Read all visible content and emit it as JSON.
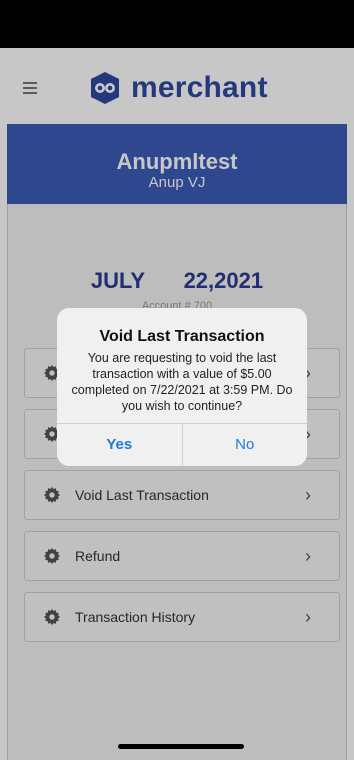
{
  "app": {
    "brand": "merchant"
  },
  "merchant": {
    "name": "Anupmltest",
    "user": "Anup VJ"
  },
  "date": {
    "month": "JULY",
    "day_year": "22,2021"
  },
  "account": {
    "text": "Account # 700"
  },
  "menu": [
    {
      "label": "",
      "icon": "gear-icon"
    },
    {
      "label": "",
      "icon": "gear-icon"
    },
    {
      "label": "Void Last Transaction",
      "icon": "gear-icon"
    },
    {
      "label": "Refund",
      "icon": "gear-icon"
    },
    {
      "label": "Transaction History",
      "icon": "gear-icon"
    }
  ],
  "dialog": {
    "title": "Void Last Transaction",
    "message": "You are requesting to void the last transaction with a value of $5.00 completed on 7/22/2021 at 3:59 PM. Do you wish to continue?",
    "yes": "Yes",
    "no": "No"
  },
  "colors": {
    "brand": "#2f4aa0",
    "banner": "#3b5cb8",
    "link": "#1f7ae0"
  }
}
